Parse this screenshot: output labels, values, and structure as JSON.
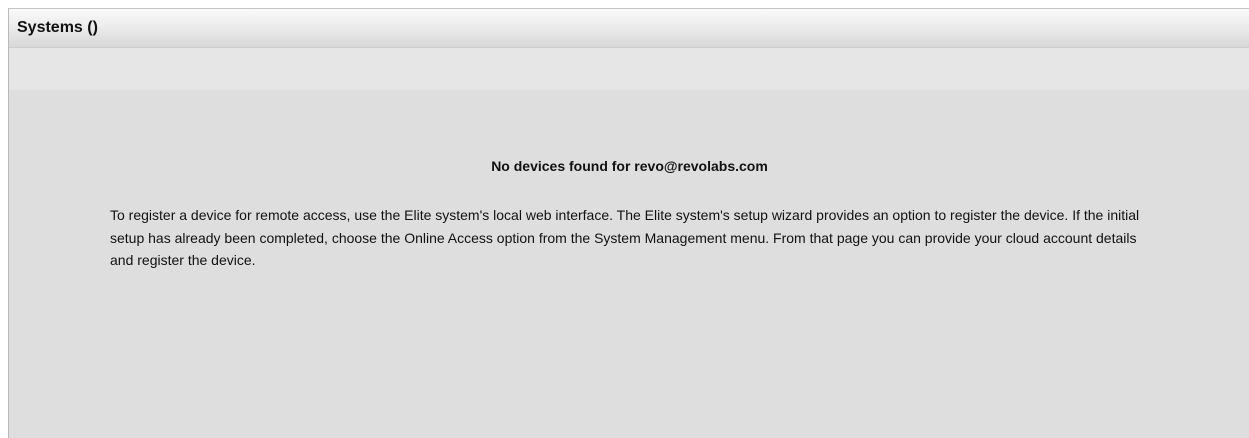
{
  "panel": {
    "title": "Systems ()"
  },
  "empty_state": {
    "heading": "No devices found for revo@revolabs.com",
    "message": "To register a device for remote access, use the Elite system's local web interface. The Elite system's setup wizard provides an option to register the device. If the initial setup has already been completed, choose the Online Access option from the System Management menu. From that page you can provide your cloud account details and register the device."
  },
  "colors": {
    "panel_background": "#dedede",
    "toolbar_background": "#e6e6e6",
    "text": "#111111"
  }
}
